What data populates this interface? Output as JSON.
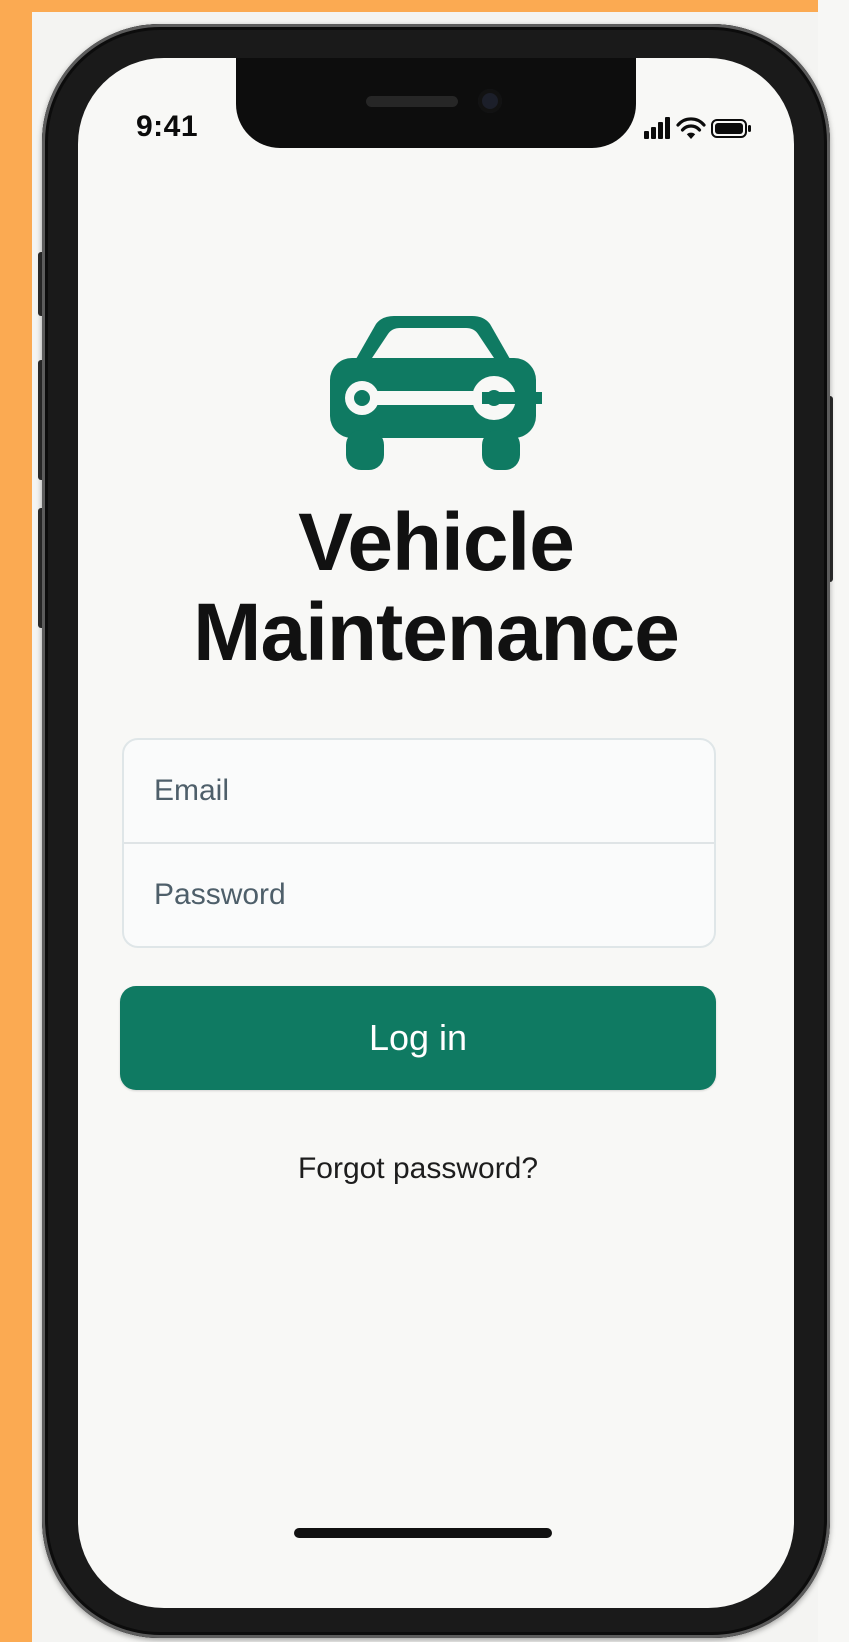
{
  "status_bar": {
    "time": "9:41",
    "icons": [
      "cellular-signal-icon",
      "wifi-icon",
      "battery-icon"
    ]
  },
  "app": {
    "logo_icon": "car-wrench-icon",
    "title_line1": "Vehicle",
    "title_line2": "Maintenance"
  },
  "login_form": {
    "email_placeholder": "Email",
    "password_placeholder": "Password",
    "login_button_label": "Log in",
    "forgot_password_link": "Forgot password?"
  },
  "colors": {
    "accent": "#0f7a62",
    "background_outer": "#fbaa52",
    "screen": "#f8f8f6",
    "text": "#111111"
  }
}
